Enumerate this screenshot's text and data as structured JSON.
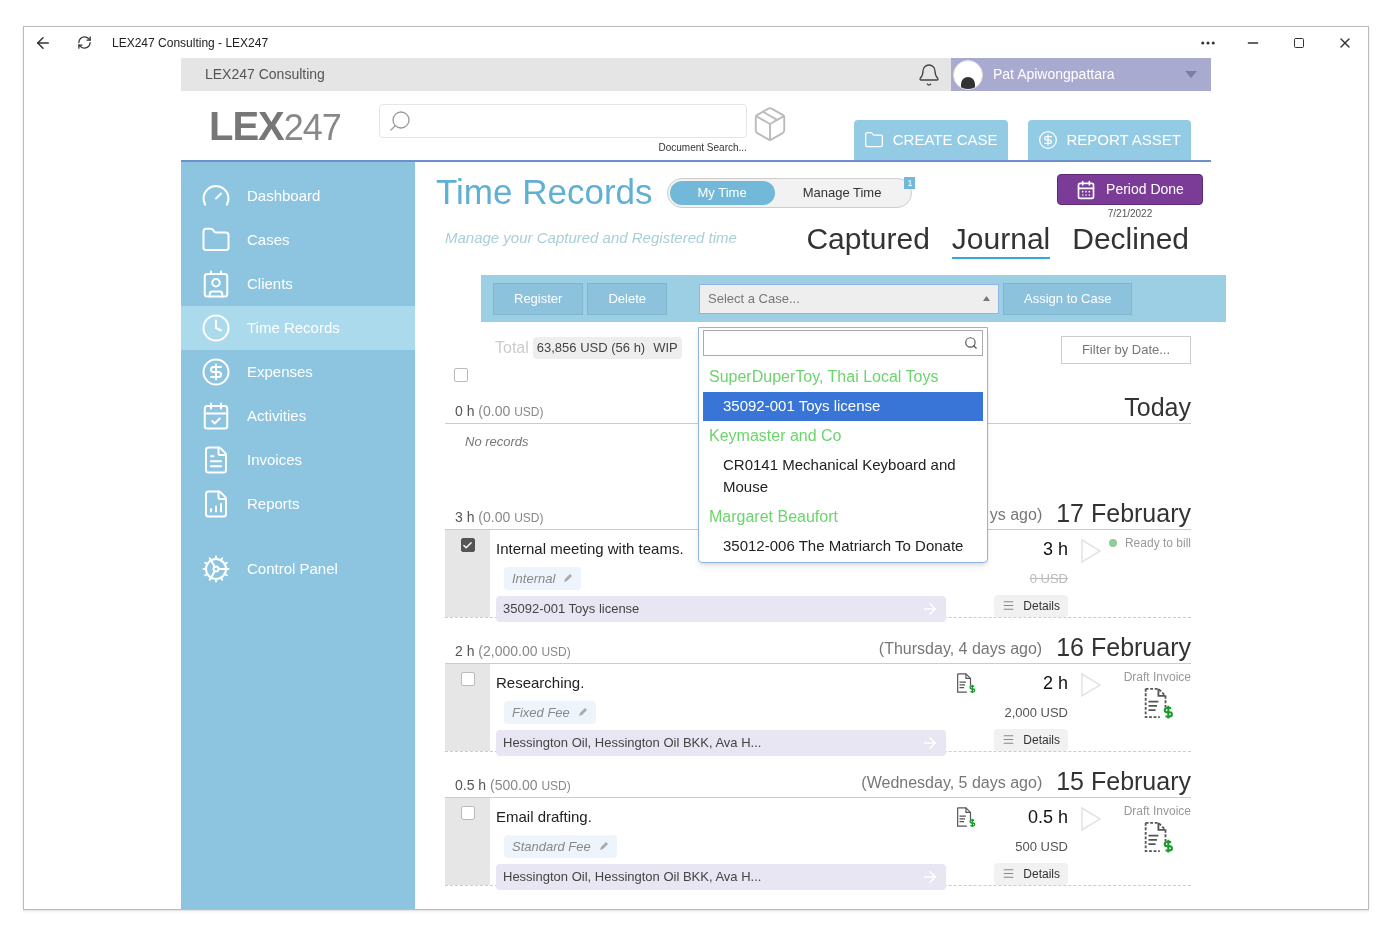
{
  "window": {
    "title": "LEX247 Consulting - LEX247"
  },
  "top_bar": {
    "organization": "LEX247 Consulting",
    "user": "Pat Apiwongpattara"
  },
  "logo": {
    "letters": "LEX",
    "digits": "247"
  },
  "document_search": {
    "label": "Document Search..."
  },
  "header_buttons": [
    {
      "label": "CREATE CASE",
      "kind": "case"
    },
    {
      "label": "REPORT ASSET",
      "kind": "asset"
    }
  ],
  "sidebar": {
    "items": [
      {
        "label": "Dashboard",
        "selected": false
      },
      {
        "label": "Cases",
        "selected": false
      },
      {
        "label": "Clients",
        "selected": false
      },
      {
        "label": "Time Records",
        "selected": true
      },
      {
        "label": "Expenses",
        "selected": false
      },
      {
        "label": "Activities",
        "selected": false
      },
      {
        "label": "Invoices",
        "selected": false
      },
      {
        "label": "Reports",
        "selected": false
      },
      {
        "label": "Control Panel",
        "selected": false
      }
    ]
  },
  "page": {
    "title": "Time Records",
    "subtitle": "Manage your Captured and Registered time",
    "mode_toggle": [
      {
        "label": "My Time",
        "selected": true
      },
      {
        "label": "Manage Time",
        "selected": false,
        "badge": "1"
      }
    ],
    "period_done": {
      "label": "Period Done",
      "date": "7/21/2022"
    },
    "view_tabs": [
      {
        "label": "Captured",
        "selected": false
      },
      {
        "label": "Journal",
        "selected": true
      },
      {
        "label": "Declined",
        "selected": false
      }
    ]
  },
  "toolbar": {
    "buttons": [
      "Register",
      "Delete"
    ],
    "case_select": {
      "placeholder": "Select a Case..."
    },
    "assign_button": "Assign to Case"
  },
  "case_dropdown": {
    "groups": [
      {
        "client": "SuperDuperToy, Thai Local Toys",
        "cases": [
          {
            "label": "35092-001 Toys license",
            "selected": true
          }
        ]
      },
      {
        "client": "Keymaster and Co",
        "cases": [
          {
            "label": "CR0141 Mechanical Keyboard and Mouse",
            "selected": false
          }
        ]
      },
      {
        "client": "Margaret Beaufort",
        "cases": [
          {
            "label": "35012-006 The Matriarch To Donate",
            "selected": false
          }
        ]
      }
    ]
  },
  "summary": {
    "label": "Total",
    "value": "63,856 USD (56 h)",
    "tag": "WIP",
    "select_all_checked": false
  },
  "filter_button": "Filter by Date...",
  "days": [
    {
      "hours": "0 h",
      "amount": "(0.00",
      "currency": "USD)",
      "date": "Today",
      "empty_text": "No records"
    },
    {
      "hours": "3 h",
      "amount": "(0.00",
      "currency": "USD)",
      "relative": "ys ago)",
      "date": "17 February",
      "entries": [
        {
          "checked": true,
          "description": "Internal meeting with teams.",
          "fee": "Internal",
          "case": "35092-001 Toys license",
          "hours": "3 h",
          "amount": "0 USD",
          "struck": true,
          "status": {
            "kind": "dot",
            "label": "Ready to bill",
            "color": "#8fcc96"
          },
          "details": "Details"
        }
      ]
    },
    {
      "hours": "2 h",
      "amount": "(2,000.00",
      "currency": "USD)",
      "relative": "(Thursday, 4 days ago)",
      "date": "16 February",
      "entries": [
        {
          "checked": false,
          "description": "Researching.",
          "fee": "Fixed Fee",
          "case": "Hessington Oil, Hessington Oil BKK, Ava H...",
          "doc_icon": true,
          "hours": "2 h",
          "amount": "2,000 USD",
          "struck": false,
          "status": {
            "kind": "invoice",
            "label": "Draft Invoice"
          },
          "details": "Details"
        }
      ]
    },
    {
      "hours": "0.5 h",
      "amount": "(500.00",
      "currency": "USD)",
      "relative": "(Wednesday, 5 days ago)",
      "date": "15 February",
      "entries": [
        {
          "checked": false,
          "description": "Email drafting.",
          "fee": "Standard Fee",
          "case": "Hessington Oil, Hessington Oil BKK, Ava H...",
          "doc_icon": true,
          "hours": "0.5 h",
          "amount": "500 USD",
          "struck": false,
          "status": {
            "kind": "invoice",
            "label": "Draft Invoice"
          },
          "details": "Details"
        }
      ]
    }
  ]
}
